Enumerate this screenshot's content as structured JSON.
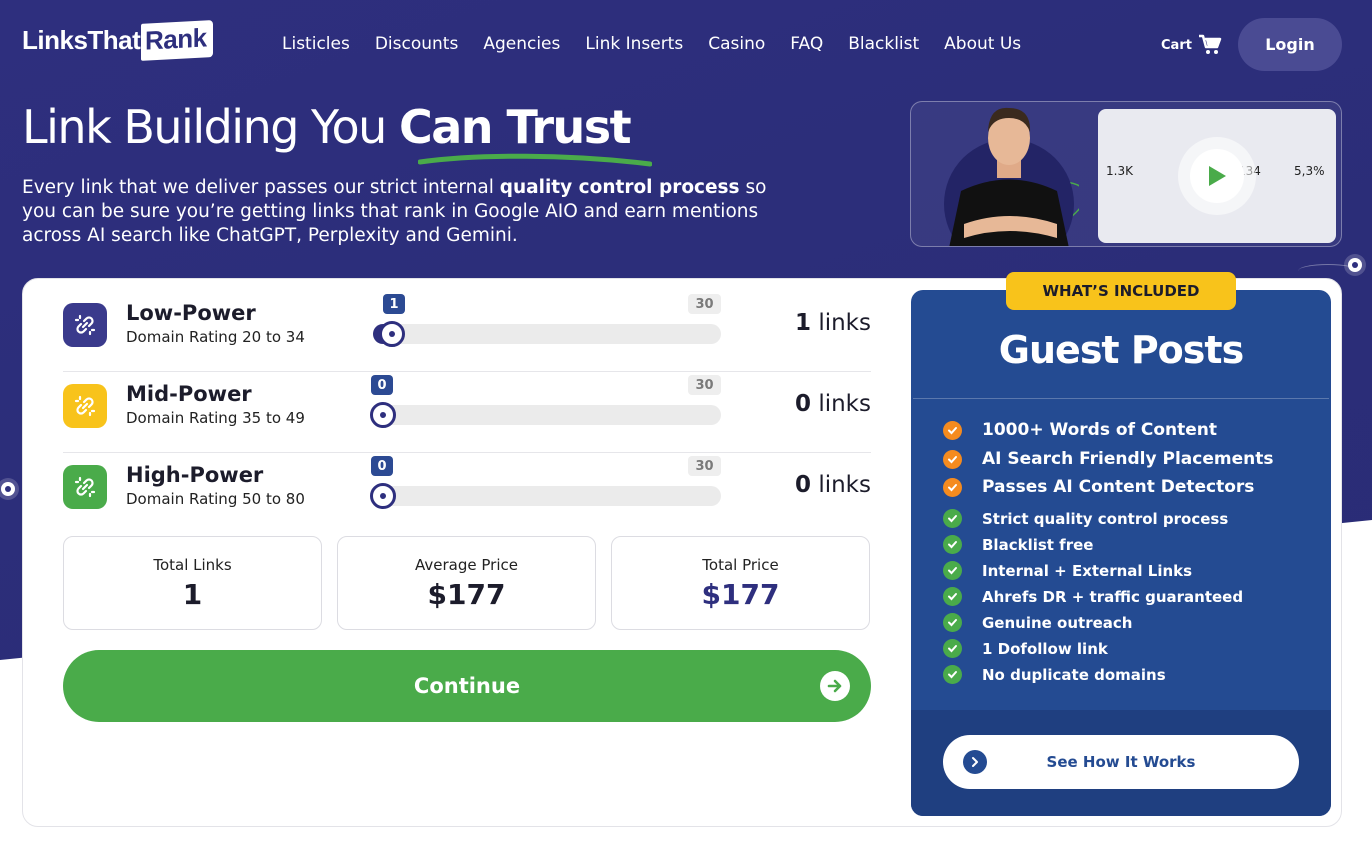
{
  "brand": {
    "logo_part1": "LinksThat",
    "logo_part2": "Rank"
  },
  "nav": {
    "items": [
      "Listicles",
      "Discounts",
      "Agencies",
      "Link Inserts",
      "Casino",
      "FAQ",
      "Blacklist",
      "About Us"
    ],
    "cart_label": "Cart",
    "login_label": "Login"
  },
  "hero": {
    "title_plain": "Link Building You ",
    "title_bold": "Can Trust",
    "sub_before": "Every link that we deliver passes our strict internal ",
    "sub_bold": "quality control process",
    "sub_after": " so you can be sure you’re getting links that rank in Google AIO and earn mentions across AI search like ChatGPT, Perplexity and Gemini."
  },
  "video": {
    "stats": [
      "1.3K",
      "134",
      "5,3%"
    ]
  },
  "tiers": [
    {
      "name": "Low-Power",
      "range": "Domain Rating 20 to 34",
      "value": "1",
      "max": "30",
      "count": "1",
      "unit": " links",
      "color": "#3a3a8c"
    },
    {
      "name": "Mid-Power",
      "range": "Domain Rating 35 to 49",
      "value": "0",
      "max": "30",
      "count": "0",
      "unit": " links",
      "color": "#f8c31b"
    },
    {
      "name": "High-Power",
      "range": "Domain Rating 50 to 80",
      "value": "0",
      "max": "30",
      "count": "0",
      "unit": " links",
      "color": "#4aab4a"
    }
  ],
  "summary": {
    "total_links_label": "Total Links",
    "total_links": "1",
    "avg_price_label": "Average Price",
    "avg_price": "$177",
    "total_price_label": "Total Price",
    "total_price": "$177"
  },
  "continue_label": "Continue",
  "included": {
    "badge": "WHAT’S INCLUDED",
    "title": "Guest Posts",
    "highlights": [
      "1000+ Words of Content",
      "AI Search Friendly Placements",
      "Passes AI Content Detectors"
    ],
    "features": [
      "Strict quality control process",
      "Blacklist free",
      "Internal + External Links",
      "Ahrefs DR + traffic guaranteed",
      "Genuine outreach",
      "1 Dofollow link",
      "No duplicate domains"
    ],
    "cta": "See How It Works",
    "highlight_color": "#f58b1f",
    "feature_color": "#4aab4a"
  }
}
